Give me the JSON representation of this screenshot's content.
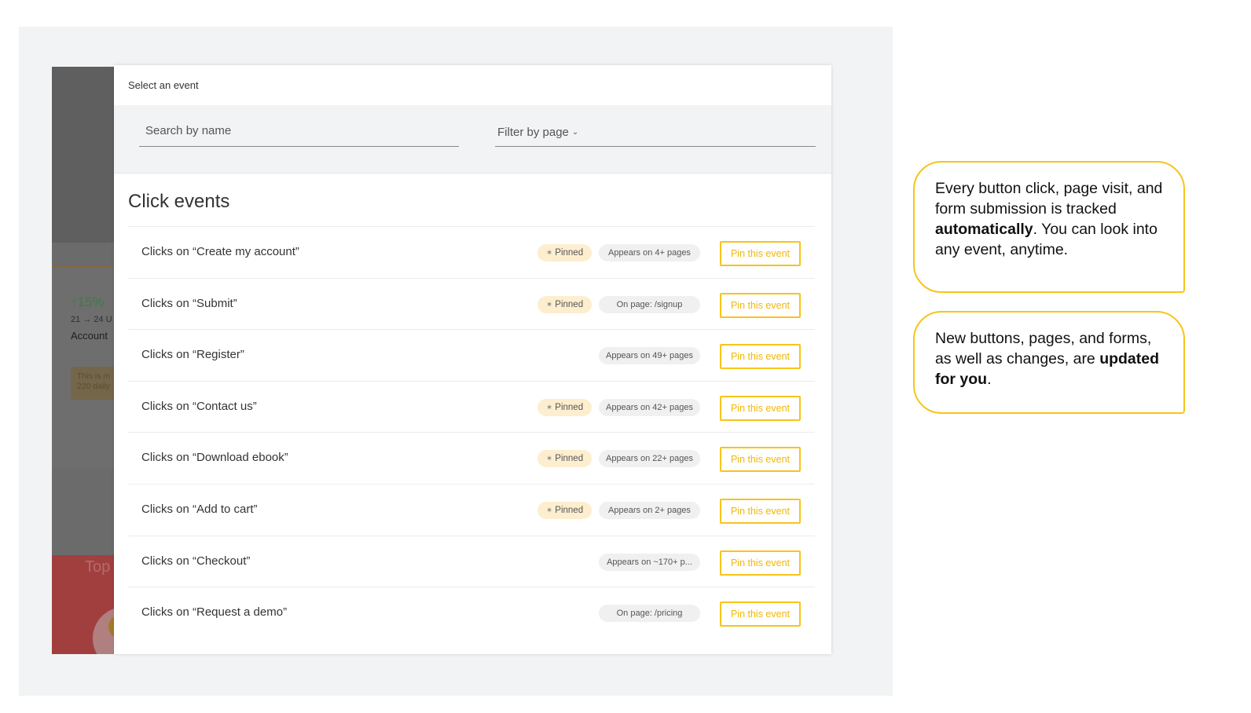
{
  "background_app": {
    "trend": "↑15%",
    "range": "21 → 24 U",
    "account": "Account",
    "note_line1": "This is m",
    "note_line2": "220 daily",
    "section": "Top"
  },
  "modal": {
    "header_title": "Select an event",
    "search_placeholder": "Search by name",
    "filter_label": "Filter by page",
    "filter_chevron": "⌄",
    "section_title": "Click events",
    "pinned_label": "Pinned",
    "pin_icon": "✶",
    "pin_button_label": "Pin this event",
    "events": [
      {
        "label": "Clicks on “Create my account”",
        "pinned": true,
        "pages": "Appears on 4+ pages"
      },
      {
        "label": "Clicks on “Submit”",
        "pinned": true,
        "pages": "On page: /signup"
      },
      {
        "label": "Clicks on “Register”",
        "pinned": false,
        "pages": "Appears on 49+ pages"
      },
      {
        "label": "Clicks on “Contact us”",
        "pinned": true,
        "pages": "Appears on 42+ pages"
      },
      {
        "label": "Clicks on “Download ebook”",
        "pinned": true,
        "pages": "Appears on 22+ pages"
      },
      {
        "label": "Clicks on “Add to cart”",
        "pinned": true,
        "pages": "Appears on 2+ pages"
      },
      {
        "label": "Clicks on “Checkout”",
        "pinned": false,
        "pages": "Appears on ~170+ p..."
      },
      {
        "label": "Clicks on “Request a demo”",
        "pinned": false,
        "pages": "On page: /pricing"
      }
    ]
  },
  "callouts": {
    "first": {
      "before": "Every button click, page visit, and form submission is tracked ",
      "bold": "automatically",
      "after": ". You can look into any event, anytime."
    },
    "second": {
      "before": "New buttons, pages, and forms, as well as changes, are ",
      "bold": "updated for you",
      "after": "."
    }
  },
  "colors": {
    "accent": "#f7c41a",
    "pinned_bg": "#fdeecf",
    "page_pill_bg": "#f0f0f0"
  }
}
